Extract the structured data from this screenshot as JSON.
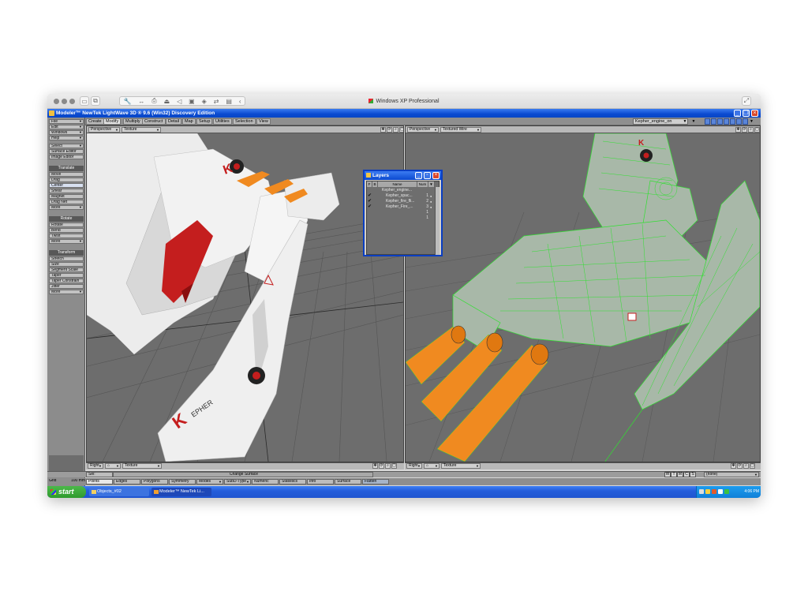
{
  "host": {
    "title": "Windows XP Professional"
  },
  "app": {
    "title": "Modeler™ NewTek LightWave 3D ® 9.6 (Win32) Discovery Edition",
    "tabs": [
      "Create",
      "Modify",
      "Multiply",
      "Construct",
      "Detail",
      "Map",
      "Setup",
      "Utilities",
      "Selection",
      "View"
    ],
    "active_tab": "Modify",
    "current_object": "Kepher_engine_on"
  },
  "toolbar": {
    "menus": [
      "File",
      "Edit",
      "Windows",
      "Help"
    ],
    "select": "Select",
    "surface_editor": "Surface Editor",
    "image_editor": "Image Editor",
    "translate_header": "Translate",
    "translate_items": [
      "Move",
      "Drag",
      "Center",
      "Shear",
      "Magnet",
      "Drag Net",
      "More"
    ],
    "rotate_header": "Rotate",
    "rotate_items": [
      "Rotate",
      "Bend",
      "Twist",
      "More"
    ],
    "transform_header": "Transform",
    "transform_items": [
      "Stretch",
      "Size",
      "Segment Scale",
      "Taper",
      "Taper Constrain",
      "Jitter",
      "More"
    ]
  },
  "viewports": {
    "left_top": {
      "view": "Perspective",
      "mode": "Texture"
    },
    "right_top": {
      "view": "Perspective",
      "mode": "Textured Wire"
    },
    "left_bottom": {
      "view": "Right",
      "mode": "Texture"
    },
    "right_bottom": {
      "view": "Right",
      "mode": "Texture"
    }
  },
  "layers": {
    "title": "Layers",
    "columns": [
      "F",
      "B",
      "Name",
      "Num"
    ],
    "rows": [
      {
        "name": "Kepher_engine...",
        "num": ""
      },
      {
        "name": "Kepher_spac...",
        "num": "1"
      },
      {
        "name": "Kepher_fire_fli...",
        "num": "2"
      },
      {
        "name": "Kepher_Fire_...",
        "num": "3"
      }
    ],
    "empty_nums": [
      "1",
      "1"
    ]
  },
  "status": {
    "sel_label": "Sel:",
    "change_surface": "Change Surface",
    "grid_label": "Grid",
    "grid_value": "100 mm",
    "mode_buttons": [
      "Points",
      "Edges",
      "Polygons",
      "Symmetry",
      "Modes",
      "SubD-Type",
      "Numeric",
      "Statistics",
      "Info",
      "Surface",
      "Flatten"
    ],
    "vmap_buttons": [
      "W",
      "T",
      "M",
      "C",
      "S"
    ],
    "vmap_value": "(none)"
  },
  "taskbar": {
    "start": "start",
    "tasks": [
      "Objects_#02",
      "Modeler™ NewTek Li..."
    ],
    "clock": "4:06 PM"
  }
}
